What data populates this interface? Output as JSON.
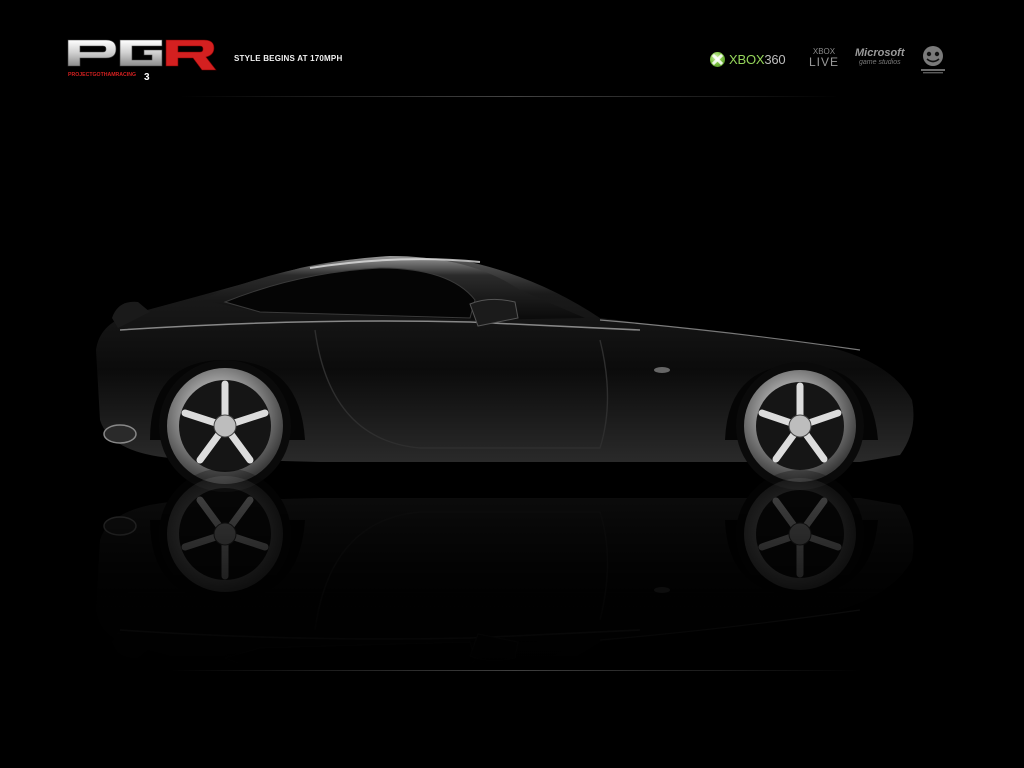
{
  "header": {
    "logo": {
      "mark": "PGR",
      "subtitle": "PROJECTGOTHAMRACING",
      "number": "3"
    },
    "tagline": "STYLE BEGINS AT 170MPH"
  },
  "brands": {
    "xbox360": {
      "prefix": "XBOX",
      "suffix": "360"
    },
    "xbox_live": {
      "line1": "XBOX",
      "line2": "LIVE"
    },
    "microsoft_game_studios": {
      "line1": "Microsoft",
      "line2": "game studios"
    },
    "bizarre_creations": {
      "icon": "bizarre-creations-icon"
    }
  },
  "colors": {
    "background": "#000000",
    "logo_red": "#d42020",
    "xbox_green": "#7fc443"
  },
  "icons": [
    "pgr-logo",
    "xbox-orb-icon",
    "bizarre-creations-icon"
  ]
}
